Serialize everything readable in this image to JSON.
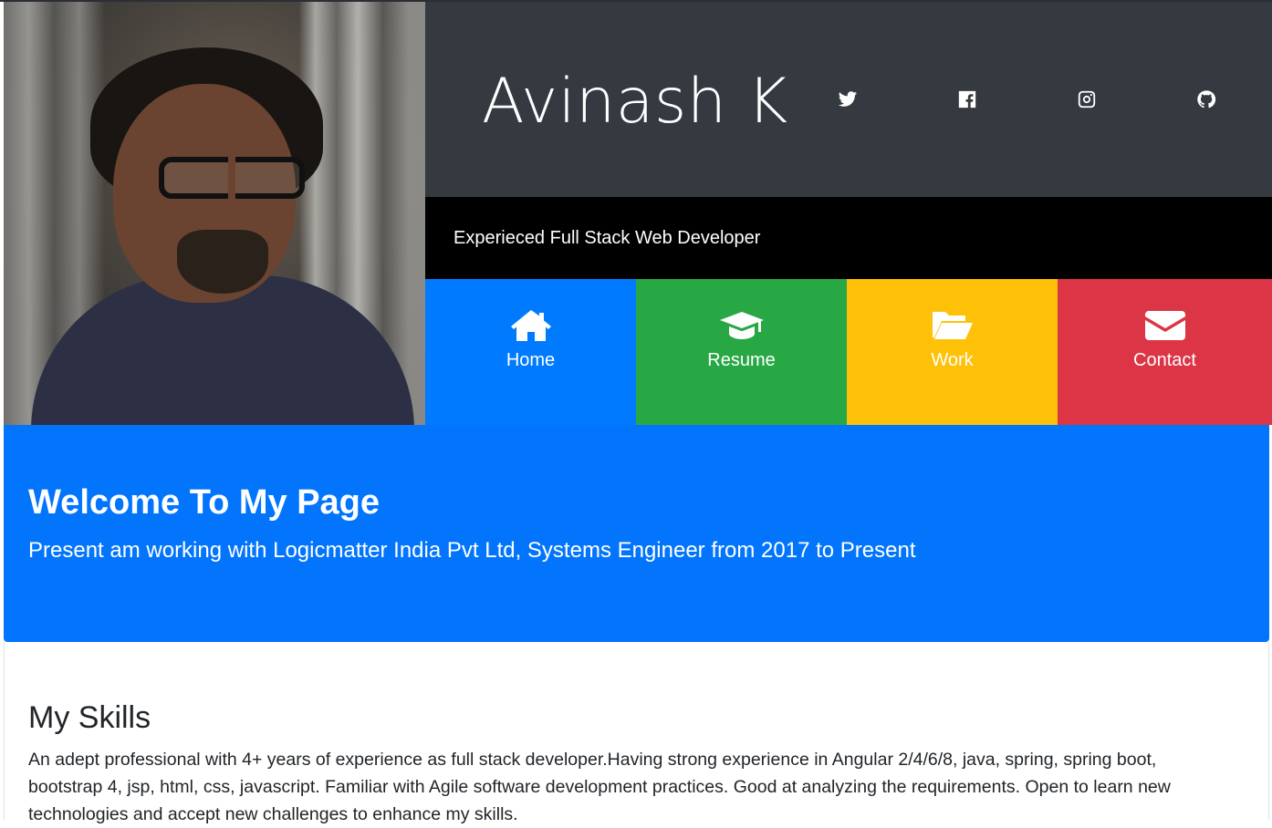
{
  "profile": {
    "name": "Avinash K",
    "tagline": "Experieced Full Stack Web Developer",
    "photo_alt": "Avinash K"
  },
  "social": [
    {
      "icon": "twitter-icon"
    },
    {
      "icon": "facebook-icon"
    },
    {
      "icon": "instagram-icon"
    },
    {
      "icon": "github-icon"
    }
  ],
  "nav": {
    "home": {
      "label": "Home",
      "icon": "home-icon",
      "color": "#007bff"
    },
    "resume": {
      "label": "Resume",
      "icon": "graduation-cap-icon",
      "color": "#28a745"
    },
    "work": {
      "label": "Work",
      "icon": "folder-open-icon",
      "color": "#ffc107"
    },
    "contact": {
      "label": "Contact",
      "icon": "envelope-icon",
      "color": "#dc3545"
    }
  },
  "welcome": {
    "title": "Welcome To My Page",
    "intro_prefix": "Present am working with Logicmatter India Pvt Ltd, ",
    "role": "Systems Engineer",
    "intro_mid": " from ",
    "period": "2017 to Present"
  },
  "skills": {
    "title": "My Skills",
    "text": "An adept professional with 4+ years of experience as full stack developer.Having strong experience in Angular 2/4/6/8, java, spring, spring boot, bootstrap 4, jsp, html, css, javascript. Familiar with Agile software development practices. Good at analyzing the requirements. Open to learn new technologies and accept new challenges to enhance my skills."
  },
  "colors": {
    "header_dark": "#343a40",
    "tagline_bg": "#000000",
    "jumbotron": "#0275fc"
  }
}
